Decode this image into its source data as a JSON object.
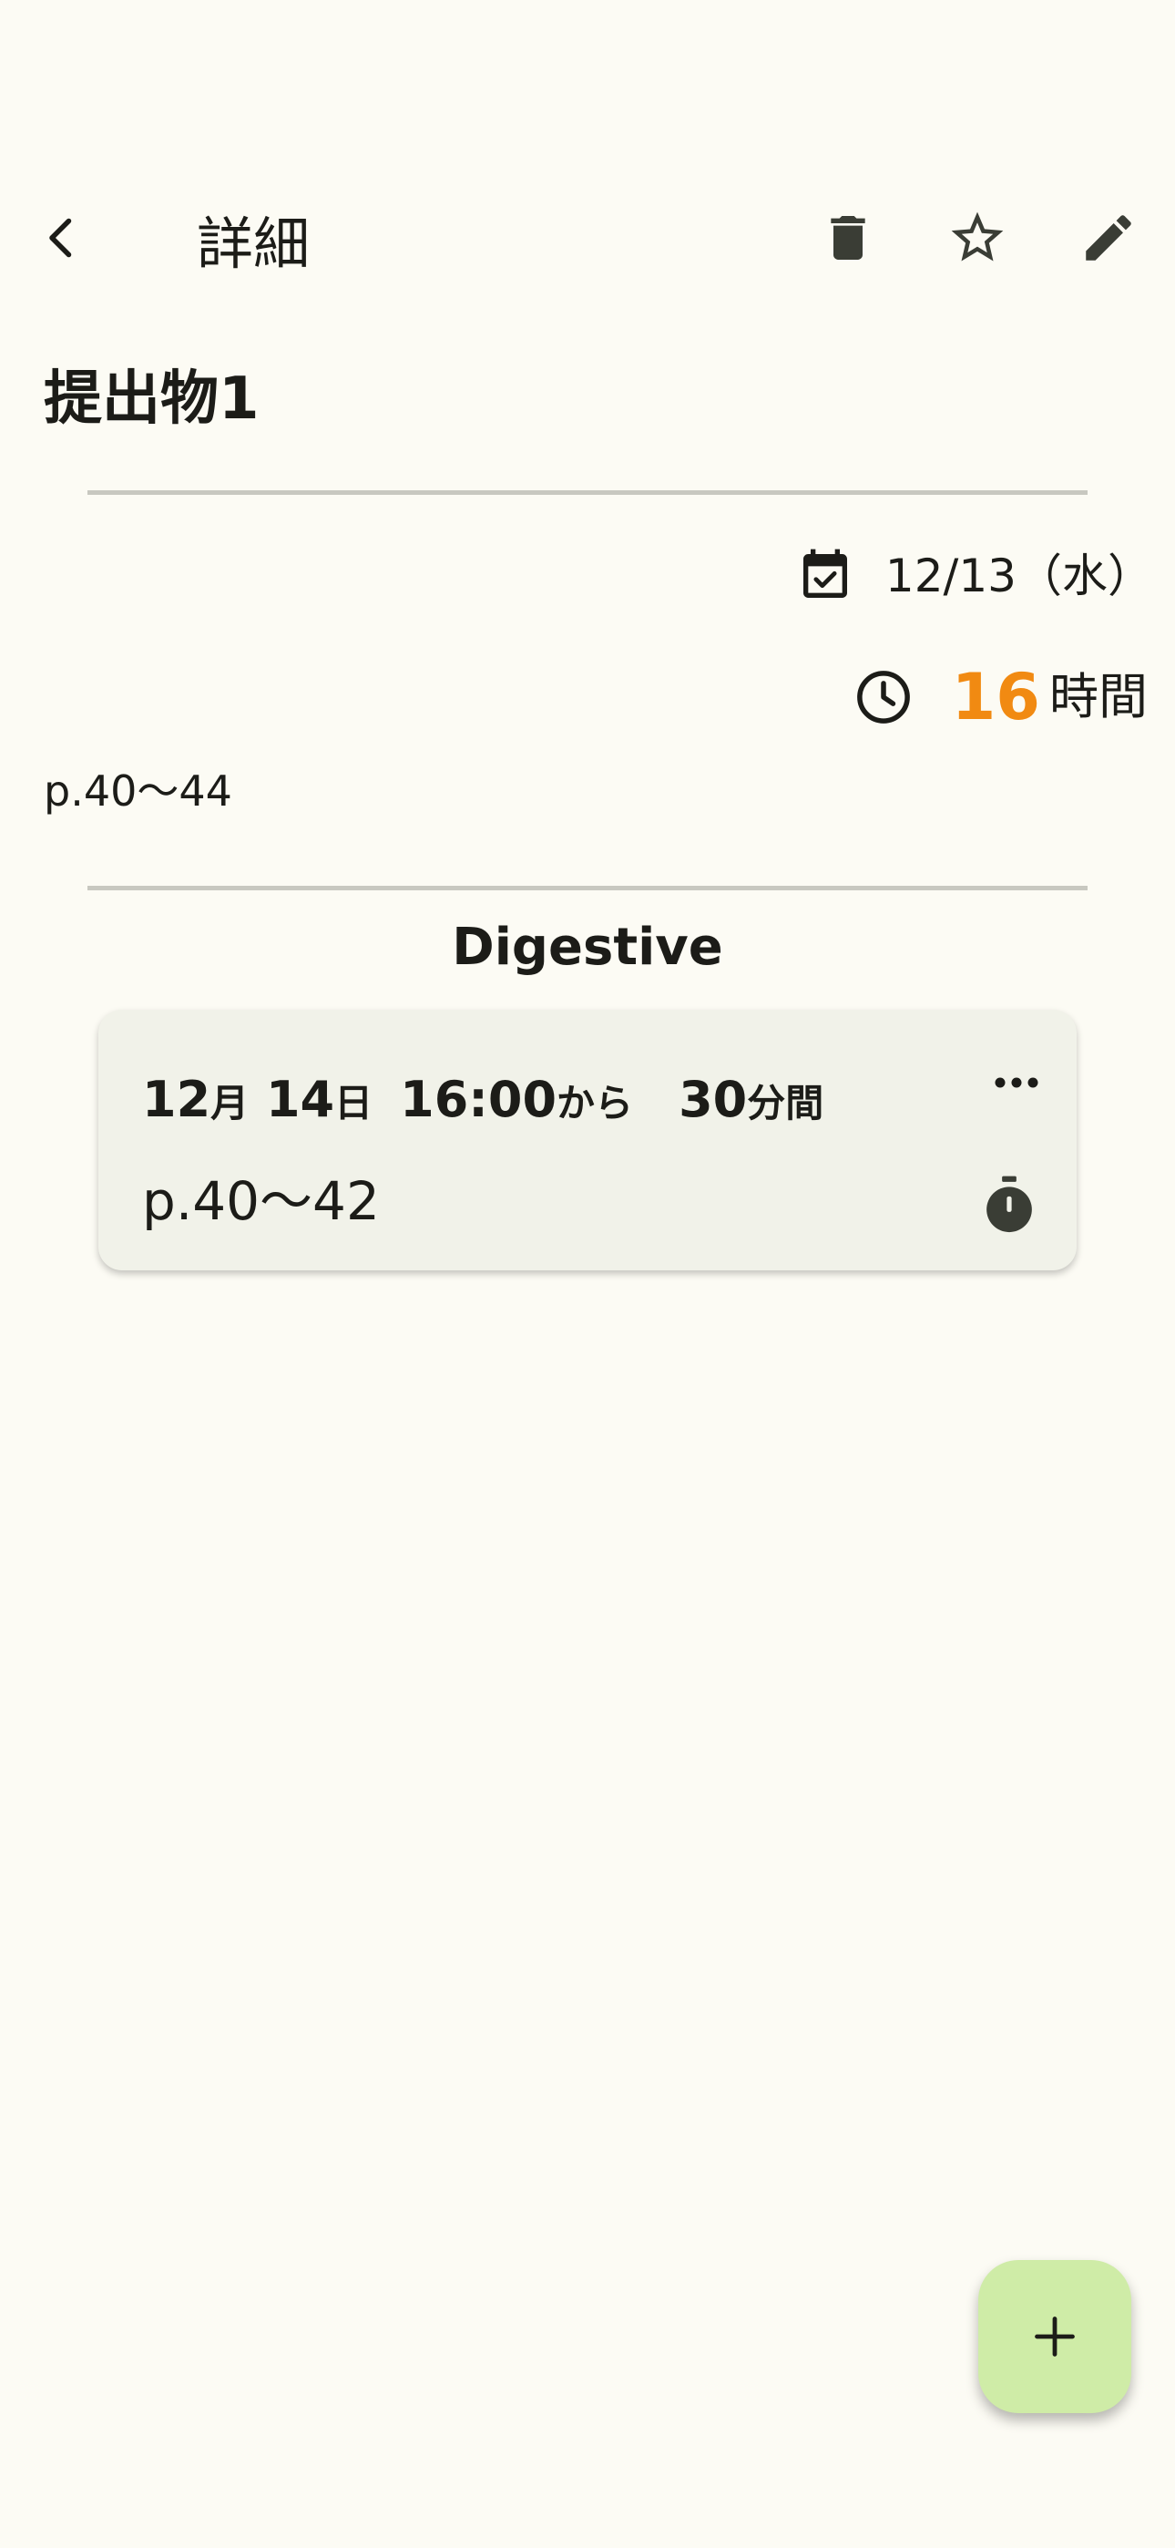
{
  "header": {
    "title": "詳細",
    "back_icon": "arrow-back-icon",
    "delete_icon": "trash-icon",
    "favorite_icon": "star-outline-icon",
    "edit_icon": "pencil-icon"
  },
  "item": {
    "title": "提出物1",
    "due_date": "12/13（水）",
    "remaining_hours": "16",
    "remaining_unit": "時間",
    "memo": "p.40〜44"
  },
  "section": {
    "title": "Digestive"
  },
  "plans": [
    {
      "month": "12",
      "month_unit": "月",
      "day": "14",
      "day_unit": "日",
      "time": "16:00",
      "time_suffix": "から",
      "duration": "30",
      "duration_unit": "分間",
      "memo": "p.40〜42"
    }
  ],
  "fab": {
    "icon": "plus-icon"
  },
  "colors": {
    "background": "#fcfbf4",
    "accent_orange": "#f18a12",
    "card_background": "#f1f2e9",
    "fab_background": "#cfeca7",
    "icon_dark": "#3a3d35"
  }
}
